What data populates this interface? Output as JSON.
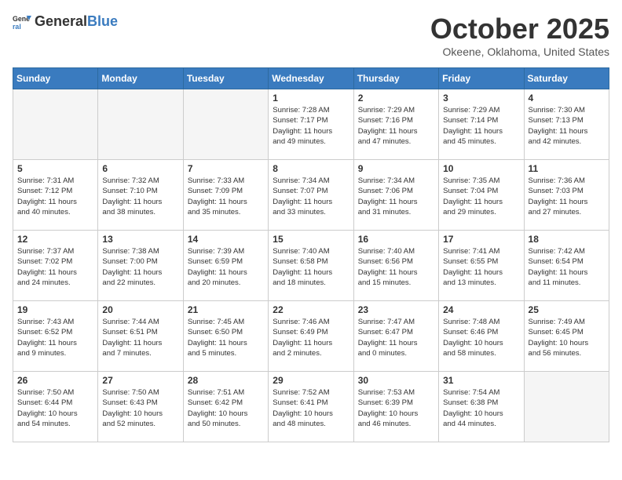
{
  "header": {
    "logo_general": "General",
    "logo_blue": "Blue",
    "month_title": "October 2025",
    "location": "Okeene, Oklahoma, United States"
  },
  "days_of_week": [
    "Sunday",
    "Monday",
    "Tuesday",
    "Wednesday",
    "Thursday",
    "Friday",
    "Saturday"
  ],
  "weeks": [
    [
      {
        "day": "",
        "info": ""
      },
      {
        "day": "",
        "info": ""
      },
      {
        "day": "",
        "info": ""
      },
      {
        "day": "1",
        "info": "Sunrise: 7:28 AM\nSunset: 7:17 PM\nDaylight: 11 hours\nand 49 minutes."
      },
      {
        "day": "2",
        "info": "Sunrise: 7:29 AM\nSunset: 7:16 PM\nDaylight: 11 hours\nand 47 minutes."
      },
      {
        "day": "3",
        "info": "Sunrise: 7:29 AM\nSunset: 7:14 PM\nDaylight: 11 hours\nand 45 minutes."
      },
      {
        "day": "4",
        "info": "Sunrise: 7:30 AM\nSunset: 7:13 PM\nDaylight: 11 hours\nand 42 minutes."
      }
    ],
    [
      {
        "day": "5",
        "info": "Sunrise: 7:31 AM\nSunset: 7:12 PM\nDaylight: 11 hours\nand 40 minutes."
      },
      {
        "day": "6",
        "info": "Sunrise: 7:32 AM\nSunset: 7:10 PM\nDaylight: 11 hours\nand 38 minutes."
      },
      {
        "day": "7",
        "info": "Sunrise: 7:33 AM\nSunset: 7:09 PM\nDaylight: 11 hours\nand 35 minutes."
      },
      {
        "day": "8",
        "info": "Sunrise: 7:34 AM\nSunset: 7:07 PM\nDaylight: 11 hours\nand 33 minutes."
      },
      {
        "day": "9",
        "info": "Sunrise: 7:34 AM\nSunset: 7:06 PM\nDaylight: 11 hours\nand 31 minutes."
      },
      {
        "day": "10",
        "info": "Sunrise: 7:35 AM\nSunset: 7:04 PM\nDaylight: 11 hours\nand 29 minutes."
      },
      {
        "day": "11",
        "info": "Sunrise: 7:36 AM\nSunset: 7:03 PM\nDaylight: 11 hours\nand 27 minutes."
      }
    ],
    [
      {
        "day": "12",
        "info": "Sunrise: 7:37 AM\nSunset: 7:02 PM\nDaylight: 11 hours\nand 24 minutes."
      },
      {
        "day": "13",
        "info": "Sunrise: 7:38 AM\nSunset: 7:00 PM\nDaylight: 11 hours\nand 22 minutes."
      },
      {
        "day": "14",
        "info": "Sunrise: 7:39 AM\nSunset: 6:59 PM\nDaylight: 11 hours\nand 20 minutes."
      },
      {
        "day": "15",
        "info": "Sunrise: 7:40 AM\nSunset: 6:58 PM\nDaylight: 11 hours\nand 18 minutes."
      },
      {
        "day": "16",
        "info": "Sunrise: 7:40 AM\nSunset: 6:56 PM\nDaylight: 11 hours\nand 15 minutes."
      },
      {
        "day": "17",
        "info": "Sunrise: 7:41 AM\nSunset: 6:55 PM\nDaylight: 11 hours\nand 13 minutes."
      },
      {
        "day": "18",
        "info": "Sunrise: 7:42 AM\nSunset: 6:54 PM\nDaylight: 11 hours\nand 11 minutes."
      }
    ],
    [
      {
        "day": "19",
        "info": "Sunrise: 7:43 AM\nSunset: 6:52 PM\nDaylight: 11 hours\nand 9 minutes."
      },
      {
        "day": "20",
        "info": "Sunrise: 7:44 AM\nSunset: 6:51 PM\nDaylight: 11 hours\nand 7 minutes."
      },
      {
        "day": "21",
        "info": "Sunrise: 7:45 AM\nSunset: 6:50 PM\nDaylight: 11 hours\nand 5 minutes."
      },
      {
        "day": "22",
        "info": "Sunrise: 7:46 AM\nSunset: 6:49 PM\nDaylight: 11 hours\nand 2 minutes."
      },
      {
        "day": "23",
        "info": "Sunrise: 7:47 AM\nSunset: 6:47 PM\nDaylight: 11 hours\nand 0 minutes."
      },
      {
        "day": "24",
        "info": "Sunrise: 7:48 AM\nSunset: 6:46 PM\nDaylight: 10 hours\nand 58 minutes."
      },
      {
        "day": "25",
        "info": "Sunrise: 7:49 AM\nSunset: 6:45 PM\nDaylight: 10 hours\nand 56 minutes."
      }
    ],
    [
      {
        "day": "26",
        "info": "Sunrise: 7:50 AM\nSunset: 6:44 PM\nDaylight: 10 hours\nand 54 minutes."
      },
      {
        "day": "27",
        "info": "Sunrise: 7:50 AM\nSunset: 6:43 PM\nDaylight: 10 hours\nand 52 minutes."
      },
      {
        "day": "28",
        "info": "Sunrise: 7:51 AM\nSunset: 6:42 PM\nDaylight: 10 hours\nand 50 minutes."
      },
      {
        "day": "29",
        "info": "Sunrise: 7:52 AM\nSunset: 6:41 PM\nDaylight: 10 hours\nand 48 minutes."
      },
      {
        "day": "30",
        "info": "Sunrise: 7:53 AM\nSunset: 6:39 PM\nDaylight: 10 hours\nand 46 minutes."
      },
      {
        "day": "31",
        "info": "Sunrise: 7:54 AM\nSunset: 6:38 PM\nDaylight: 10 hours\nand 44 minutes."
      },
      {
        "day": "",
        "info": ""
      }
    ]
  ]
}
